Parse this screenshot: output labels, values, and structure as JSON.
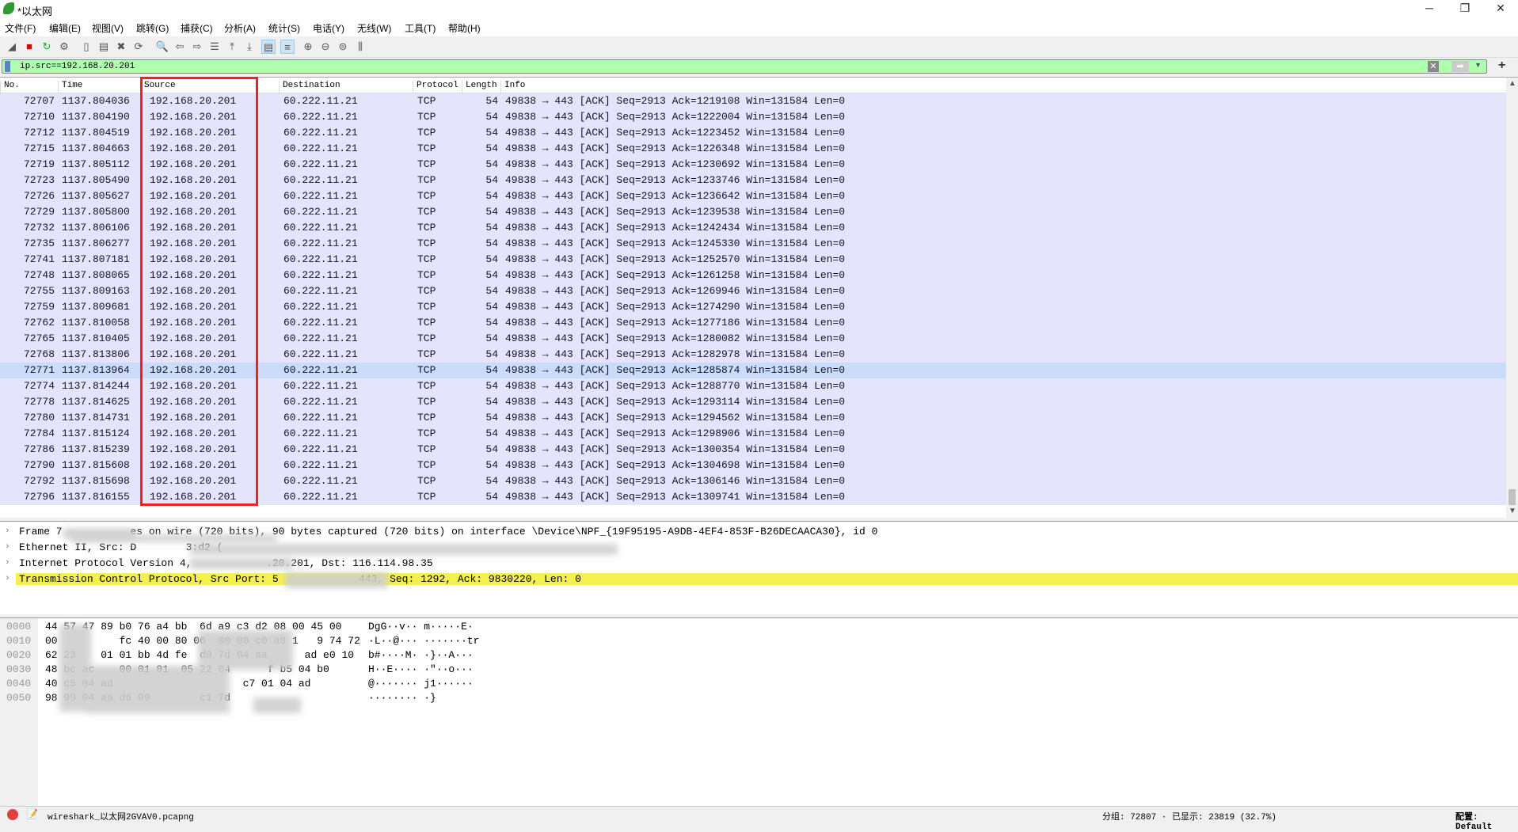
{
  "window": {
    "title": "*以太网",
    "minimize": "─",
    "restore": "❐",
    "close": "✕"
  },
  "menu": [
    "文件(F)",
    "编辑(E)",
    "视图(V)",
    "跳转(G)",
    "捕获(C)",
    "分析(A)",
    "统计(S)",
    "电话(Y)",
    "无线(W)",
    "工具(T)",
    "帮助(H)"
  ],
  "toolbar": [
    {
      "icon": "shark-fin-start-icon",
      "glyph": "◢"
    },
    {
      "icon": "stop-capture-icon",
      "glyph": "■"
    },
    {
      "icon": "restart-capture-icon",
      "glyph": "↻"
    },
    {
      "icon": "capture-options-icon",
      "glyph": "⚙"
    },
    {
      "icon": "open-file-icon",
      "glyph": "▯"
    },
    {
      "icon": "save-file-icon",
      "glyph": "▤"
    },
    {
      "icon": "close-file-icon",
      "glyph": "✖"
    },
    {
      "icon": "reload-file-icon",
      "glyph": "⟳"
    },
    {
      "icon": "find-packet-icon",
      "glyph": "🔍"
    },
    {
      "icon": "go-back-icon",
      "glyph": "⇦"
    },
    {
      "icon": "go-forward-icon",
      "glyph": "⇨"
    },
    {
      "icon": "go-to-packet-icon",
      "glyph": "☰"
    },
    {
      "icon": "first-packet-icon",
      "glyph": "⤒"
    },
    {
      "icon": "last-packet-icon",
      "glyph": "⤓"
    },
    {
      "icon": "auto-scroll-icon",
      "glyph": "▤"
    },
    {
      "icon": "colorize-icon",
      "glyph": "≡"
    },
    {
      "icon": "zoom-in-icon",
      "glyph": "⊕"
    },
    {
      "icon": "zoom-out-icon",
      "glyph": "⊖"
    },
    {
      "icon": "normal-size-icon",
      "glyph": "⊜"
    },
    {
      "icon": "resize-columns-icon",
      "glyph": "⫼"
    }
  ],
  "filter": {
    "value": "ip.src==192.168.20.201",
    "add": "+"
  },
  "columns": [
    "No.",
    "Time",
    "Source",
    "Destination",
    "Protocol",
    "Length",
    "Info"
  ],
  "packets": [
    [
      "72707",
      "1137.804036",
      "192.168.20.201",
      "60.222.11.21",
      "TCP",
      "54",
      "49838 → 443 [ACK] Seq=2913 Ack=1219108 Win=131584 Len=0"
    ],
    [
      "72710",
      "1137.804190",
      "192.168.20.201",
      "60.222.11.21",
      "TCP",
      "54",
      "49838 → 443 [ACK] Seq=2913 Ack=1222004 Win=131584 Len=0"
    ],
    [
      "72712",
      "1137.804519",
      "192.168.20.201",
      "60.222.11.21",
      "TCP",
      "54",
      "49838 → 443 [ACK] Seq=2913 Ack=1223452 Win=131584 Len=0"
    ],
    [
      "72715",
      "1137.804663",
      "192.168.20.201",
      "60.222.11.21",
      "TCP",
      "54",
      "49838 → 443 [ACK] Seq=2913 Ack=1226348 Win=131584 Len=0"
    ],
    [
      "72719",
      "1137.805112",
      "192.168.20.201",
      "60.222.11.21",
      "TCP",
      "54",
      "49838 → 443 [ACK] Seq=2913 Ack=1230692 Win=131584 Len=0"
    ],
    [
      "72723",
      "1137.805490",
      "192.168.20.201",
      "60.222.11.21",
      "TCP",
      "54",
      "49838 → 443 [ACK] Seq=2913 Ack=1233746 Win=131584 Len=0"
    ],
    [
      "72726",
      "1137.805627",
      "192.168.20.201",
      "60.222.11.21",
      "TCP",
      "54",
      "49838 → 443 [ACK] Seq=2913 Ack=1236642 Win=131584 Len=0"
    ],
    [
      "72729",
      "1137.805800",
      "192.168.20.201",
      "60.222.11.21",
      "TCP",
      "54",
      "49838 → 443 [ACK] Seq=2913 Ack=1239538 Win=131584 Len=0"
    ],
    [
      "72732",
      "1137.806106",
      "192.168.20.201",
      "60.222.11.21",
      "TCP",
      "54",
      "49838 → 443 [ACK] Seq=2913 Ack=1242434 Win=131584 Len=0"
    ],
    [
      "72735",
      "1137.806277",
      "192.168.20.201",
      "60.222.11.21",
      "TCP",
      "54",
      "49838 → 443 [ACK] Seq=2913 Ack=1245330 Win=131584 Len=0"
    ],
    [
      "72741",
      "1137.807181",
      "192.168.20.201",
      "60.222.11.21",
      "TCP",
      "54",
      "49838 → 443 [ACK] Seq=2913 Ack=1252570 Win=131584 Len=0"
    ],
    [
      "72748",
      "1137.808065",
      "192.168.20.201",
      "60.222.11.21",
      "TCP",
      "54",
      "49838 → 443 [ACK] Seq=2913 Ack=1261258 Win=131584 Len=0"
    ],
    [
      "72755",
      "1137.809163",
      "192.168.20.201",
      "60.222.11.21",
      "TCP",
      "54",
      "49838 → 443 [ACK] Seq=2913 Ack=1269946 Win=131584 Len=0"
    ],
    [
      "72759",
      "1137.809681",
      "192.168.20.201",
      "60.222.11.21",
      "TCP",
      "54",
      "49838 → 443 [ACK] Seq=2913 Ack=1274290 Win=131584 Len=0"
    ],
    [
      "72762",
      "1137.810058",
      "192.168.20.201",
      "60.222.11.21",
      "TCP",
      "54",
      "49838 → 443 [ACK] Seq=2913 Ack=1277186 Win=131584 Len=0"
    ],
    [
      "72765",
      "1137.810405",
      "192.168.20.201",
      "60.222.11.21",
      "TCP",
      "54",
      "49838 → 443 [ACK] Seq=2913 Ack=1280082 Win=131584 Len=0"
    ],
    [
      "72768",
      "1137.813806",
      "192.168.20.201",
      "60.222.11.21",
      "TCP",
      "54",
      "49838 → 443 [ACK] Seq=2913 Ack=1282978 Win=131584 Len=0"
    ],
    [
      "72771",
      "1137.813964",
      "192.168.20.201",
      "60.222.11.21",
      "TCP",
      "54",
      "49838 → 443 [ACK] Seq=2913 Ack=1285874 Win=131584 Len=0"
    ],
    [
      "72774",
      "1137.814244",
      "192.168.20.201",
      "60.222.11.21",
      "TCP",
      "54",
      "49838 → 443 [ACK] Seq=2913 Ack=1288770 Win=131584 Len=0"
    ],
    [
      "72778",
      "1137.814625",
      "192.168.20.201",
      "60.222.11.21",
      "TCP",
      "54",
      "49838 → 443 [ACK] Seq=2913 Ack=1293114 Win=131584 Len=0"
    ],
    [
      "72780",
      "1137.814731",
      "192.168.20.201",
      "60.222.11.21",
      "TCP",
      "54",
      "49838 → 443 [ACK] Seq=2913 Ack=1294562 Win=131584 Len=0"
    ],
    [
      "72784",
      "1137.815124",
      "192.168.20.201",
      "60.222.11.21",
      "TCP",
      "54",
      "49838 → 443 [ACK] Seq=2913 Ack=1298906 Win=131584 Len=0"
    ],
    [
      "72786",
      "1137.815239",
      "192.168.20.201",
      "60.222.11.21",
      "TCP",
      "54",
      "49838 → 443 [ACK] Seq=2913 Ack=1300354 Win=131584 Len=0"
    ],
    [
      "72790",
      "1137.815608",
      "192.168.20.201",
      "60.222.11.21",
      "TCP",
      "54",
      "49838 → 443 [ACK] Seq=2913 Ack=1304698 Win=131584 Len=0"
    ],
    [
      "72792",
      "1137.815698",
      "192.168.20.201",
      "60.222.11.21",
      "TCP",
      "54",
      "49838 → 443 [ACK] Seq=2913 Ack=1306146 Win=131584 Len=0"
    ],
    [
      "72796",
      "1137.816155",
      "192.168.20.201",
      "60.222.11.21",
      "TCP",
      "54",
      "49838 → 443 [ACK] Seq=2913 Ack=1309741 Win=131584 Len=0"
    ]
  ],
  "selected_packet": "72771",
  "colors": {
    "tcp_row": "#e4e4fc",
    "selected_row": "#cbdcfa",
    "filter_valid": "#afffaf",
    "highlight": "#f4f050",
    "annotation_box": "#f02020"
  },
  "details": [
    "Frame 7           es on wire (720 bits), 90 bytes captured (720 bits) on interface \\Device\\NPF_{19F95195-A9DB-4EF4-853F-B26DECAACA30}, id 0",
    "Ethernet II, Src: D        3:d2 (",
    "Internet Protocol Version 4,            .20.201, Dst: 116.114.98.35",
    "Transmission Control Protocol, Src Port: 5             443, Seq: 1292, Ack: 9830220, Len: 0"
  ],
  "bytes": [
    [
      "0000",
      "44 57 47 89 b0 76 a4 bb  6d a9 c3 d2 08 00 45 00",
      "DgG··v·· m·····E·"
    ],
    [
      "0010",
      "00          fc 40 00 80 06  00 00 c0 a8 1   9 74 72",
      "·L··@··· ·······tr"
    ],
    [
      "0020",
      "62 23    01 01 bb 4d fe  d0 7d 04 aa      ad e0 10",
      "b#····M· ·}··A···"
    ],
    [
      "0030",
      "48 bc ac    00 01 01  05 22 04      f b5 04 b0",
      "H··E···· ·\"··o···"
    ],
    [
      "0040",
      "40 c5 04 ad                     c7 01 04 ad",
      "@······· j1······"
    ],
    [
      "0050",
      "98 99 04 aa d6 99        c1 7d",
      "········ ·}"
    ]
  ],
  "status": {
    "file": "wireshark_以太网2GVAV0.pcapng",
    "packets": "分组: 72807 · 已显示: 23819 (32.7%)",
    "profile": "配置: Default"
  }
}
